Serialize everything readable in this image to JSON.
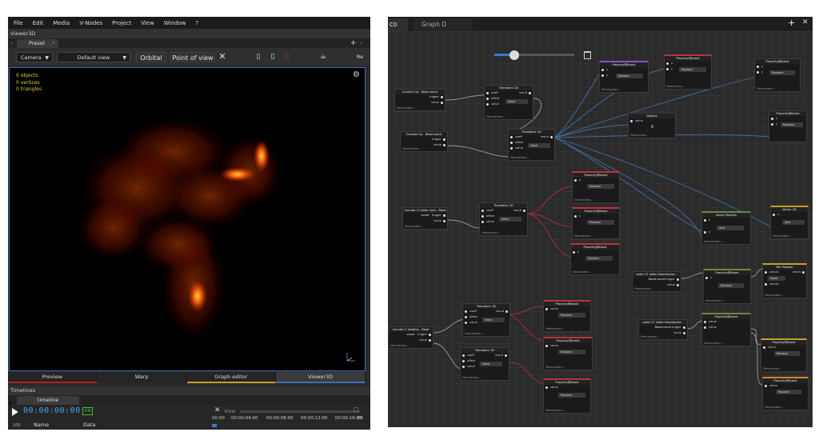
{
  "left": {
    "menu": [
      "File",
      "Edit",
      "Media",
      "V-Nodes",
      "Project",
      "View",
      "Window",
      "?"
    ],
    "panel_title": "Viewer3D",
    "tab_label": "Preset",
    "toolbar": {
      "camera": "Camera",
      "default_view": "Default view",
      "orbital": "Orbital",
      "point_of_view": "Point of view",
      "re": "Re"
    },
    "stats": {
      "objects": "0 objects",
      "vertices": "0 vertices",
      "triangles": "0 triangles"
    },
    "bottom_tabs": [
      "Preview",
      "Warp",
      "Graph editor",
      "Viewer3D"
    ],
    "timelines_title": "Timelines",
    "timeline_tab": "timeline",
    "timecode": "00:00:00:00",
    "on_badge": "ON",
    "view_label": "View",
    "col_name": "Name",
    "col_data": "Data",
    "ruler": [
      "00:00",
      "00:00:04:00",
      "00:00:08:00",
      "00:00:12:00",
      "00:00:16:00",
      "00"
    ],
    "small_left": "100",
    "colors": {
      "viewport_border": "#3d6fb4",
      "stats_text": "#e0d52c",
      "timecode": "#4aa3df",
      "on": "#3bbf3b",
      "preview_ul": "#b02020",
      "graph_ul": "#c8a020"
    }
  },
  "right": {
    "tab_active": "C0",
    "tab_other": "Graph D",
    "plus": "+",
    "close": "✕",
    "slider_value_fraction": 0.25,
    "nodes": {
      "counter_a": {
        "title": "Counter Cq - Read count",
        "trigger": "trigger",
        "value": "value",
        "desc": "Description..."
      },
      "counter_b": {
        "title": "Counter Cp - Read count",
        "trigger": "trigger",
        "value": "value",
        "desc": "Description..."
      },
      "counter_c": {
        "title": "Counter Cl slider scan - Read count",
        "trigger": "trigger",
        "value": "value",
        "desc": "Description..."
      },
      "counter_d": {
        "title": "Counter C rotation - Read count",
        "trigger": "trigger",
        "value": "value",
        "desc": "Description..."
      },
      "counter_e": {
        "title": "anter C1 slider ttendrapion - Read count",
        "trigger": "trigger",
        "value": "value",
        "desc": "Description..."
      },
      "counter_f": {
        "title": "anter C1 slider ttendrapion - Read count",
        "trigger": "trigger",
        "value": "value",
        "desc": "Description..."
      },
      "transform": {
        "title": "Transform 1D",
        "coeff": "coeff",
        "offset": "offset",
        "value": "value",
        "result": "result",
        "mode": "None",
        "desc": "Description..."
      },
      "prop": {
        "title": "Property@Iband",
        "value": "value",
        "mode": "Replace",
        "desc": "Description..."
      },
      "display": {
        "title": "Display",
        "value": "value",
        "val": "0",
        "desc": "Description..."
      },
      "add": {
        "title": "Add",
        "x": "x",
        "y": "y",
        "mode": "Add",
        "desc": "Description..."
      },
      "select_add": {
        "title": "Select Position",
        "mode": "Add"
      },
      "vec_sub": {
        "title": "Vector 2D"
      },
      "mix": {
        "title": "Mix Position",
        "value1": "value1",
        "value2": "value2",
        "result": "result",
        "desc": "Description..."
      }
    }
  }
}
